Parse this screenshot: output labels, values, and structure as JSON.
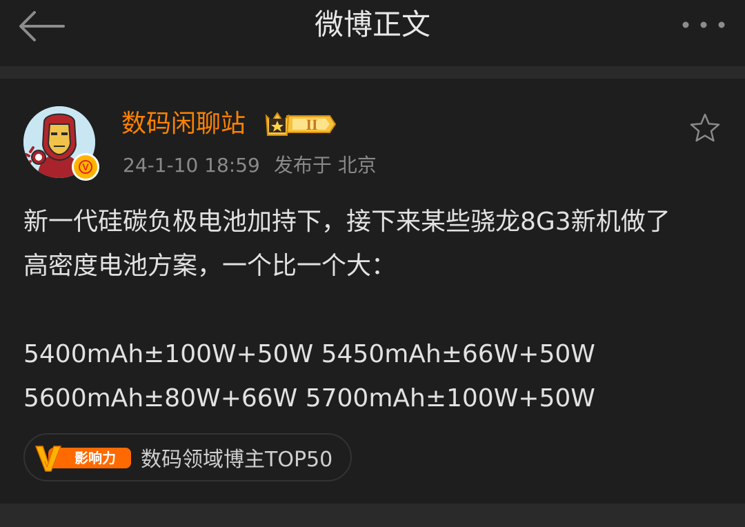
{
  "header": {
    "title": "微博正文",
    "back_icon": "arrow-left-icon",
    "more_icon": "more-horizontal-icon"
  },
  "post": {
    "author": "数码闲聊站",
    "verified_mark": "V",
    "member_level": "II",
    "time": "24-1-10 18:59",
    "location": "发布于 北京",
    "body": "新一代硅碳负极电池加持下，接下来某些骁龙8G3新机做了\n高密度电池方案，一个比一个大：\n\n5400mAh±100W+50W  5450mAh±66W+50W\n5600mAh±80W+66W  5700mAh±100W+50W",
    "influence_badge_text": "影响力",
    "influence_badge_letter": "V",
    "influence_label": "数码领域博主TOP50"
  },
  "colors": {
    "background": "#1e1e1e",
    "separator": "#2a2a2a",
    "username": "#ff8200",
    "meta": "#8a8a8a",
    "body_text": "#e2e2e2",
    "verified": "#ffb400"
  }
}
